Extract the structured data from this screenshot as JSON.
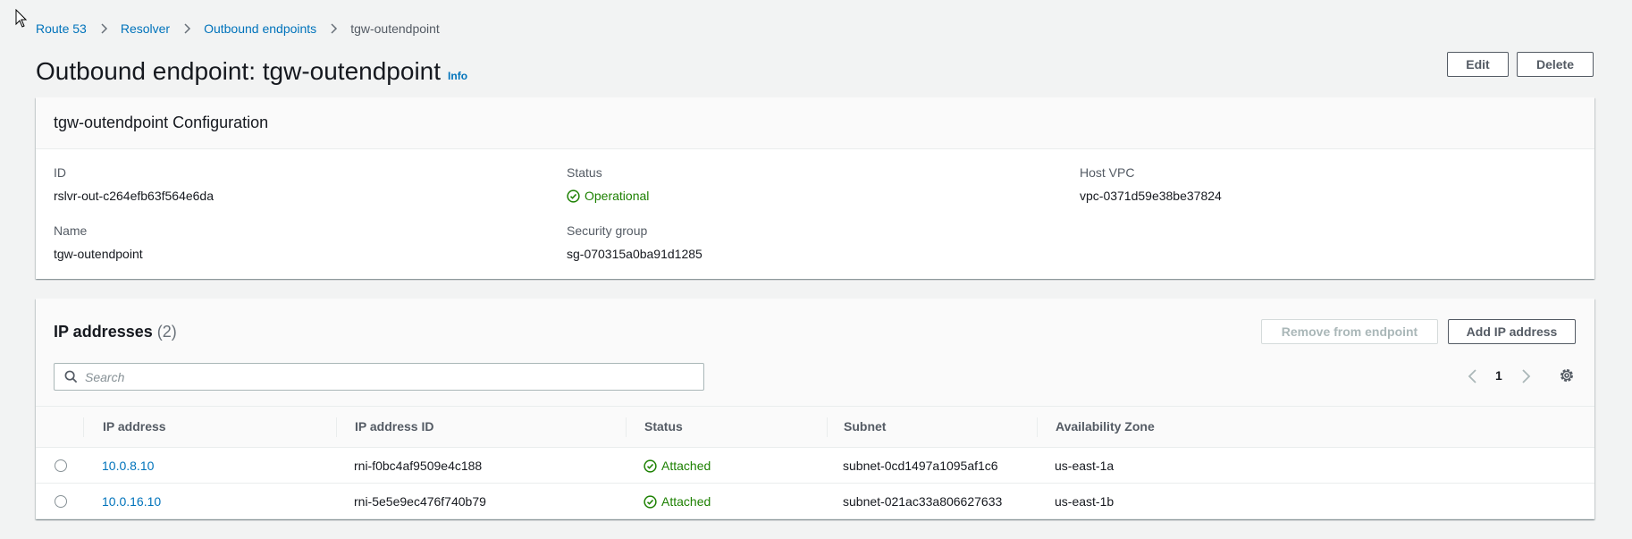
{
  "breadcrumb": {
    "items": [
      "Route 53",
      "Resolver",
      "Outbound endpoints"
    ],
    "current": "tgw-outendpoint"
  },
  "page": {
    "title": "Outbound endpoint: tgw-outendpoint",
    "info": "Info",
    "edit_label": "Edit",
    "delete_label": "Delete"
  },
  "config": {
    "header": "tgw-outendpoint Configuration",
    "id_label": "ID",
    "id_value": "rslvr-out-c264efb63f564e6da",
    "status_label": "Status",
    "status_value": "Operational",
    "host_vpc_label": "Host VPC",
    "host_vpc_value": "vpc-0371d59e38be37824",
    "name_label": "Name",
    "name_value": "tgw-outendpoint",
    "sg_label": "Security group",
    "sg_value": "sg-070315a0ba91d1285"
  },
  "ip_section": {
    "title": "IP addresses",
    "count": "(2)",
    "remove_label": "Remove from endpoint",
    "add_label": "Add IP address",
    "search_placeholder": "Search",
    "page_number": "1",
    "columns": [
      "IP address",
      "IP address ID",
      "Status",
      "Subnet",
      "Availability Zone"
    ],
    "rows": [
      {
        "ip": "10.0.8.10",
        "ip_id": "rni-f0bc4af9509e4c188",
        "status": "Attached",
        "subnet": "subnet-0cd1497a1095af1c6",
        "az": "us-east-1a"
      },
      {
        "ip": "10.0.16.10",
        "ip_id": "rni-5e5e9ec476f740b79",
        "status": "Attached",
        "subnet": "subnet-021ac33a806627633",
        "az": "us-east-1b"
      }
    ]
  },
  "colors": {
    "link": "#0073bb",
    "success": "#1d8102",
    "background": "#f2f3f3"
  }
}
